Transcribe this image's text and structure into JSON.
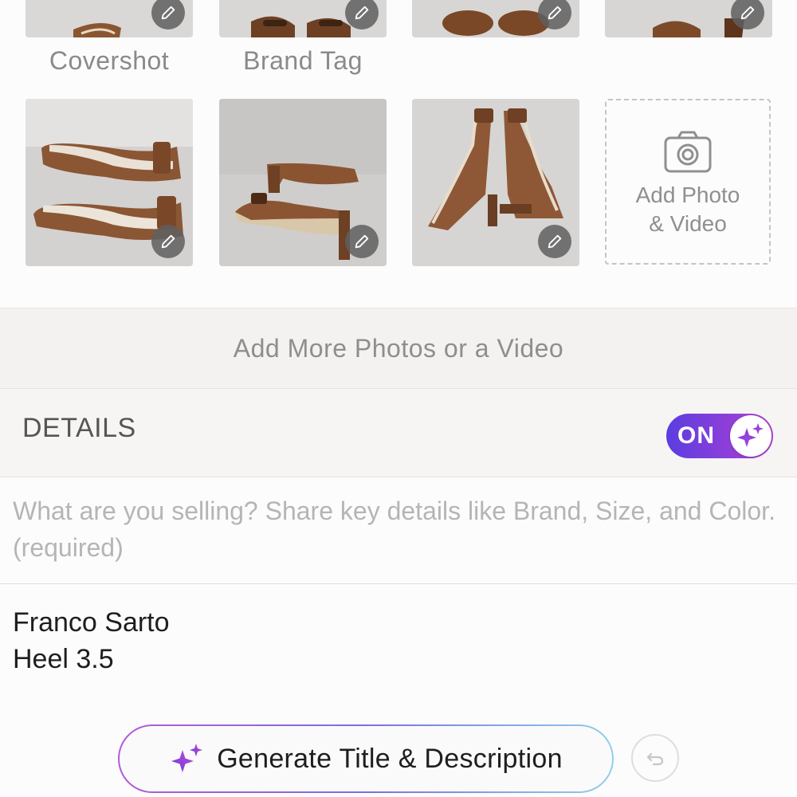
{
  "photos": {
    "labels": {
      "covershot": "Covershot",
      "brand_tag": "Brand Tag"
    },
    "add_tile": {
      "label": "Add Photo\n& Video",
      "icon": "camera-icon"
    },
    "edit_icon": "pencil-icon"
  },
  "add_more": {
    "label": "Add More Photos or a Video"
  },
  "details": {
    "title": "DETAILS",
    "ai_toggle": {
      "state_label": "ON",
      "icon": "sparkle-icon",
      "colors": [
        "#5b3de0",
        "#b046d6"
      ]
    },
    "prompt_placeholder": "What are you selling? Share key details like Brand, Size, and Color. (required)",
    "description_value": "Franco Sarto\nHeel 3.5"
  },
  "actions": {
    "generate_label": "Generate Title & Description",
    "generate_icon": "sparkle-icon",
    "undo_icon": "undo-icon"
  }
}
